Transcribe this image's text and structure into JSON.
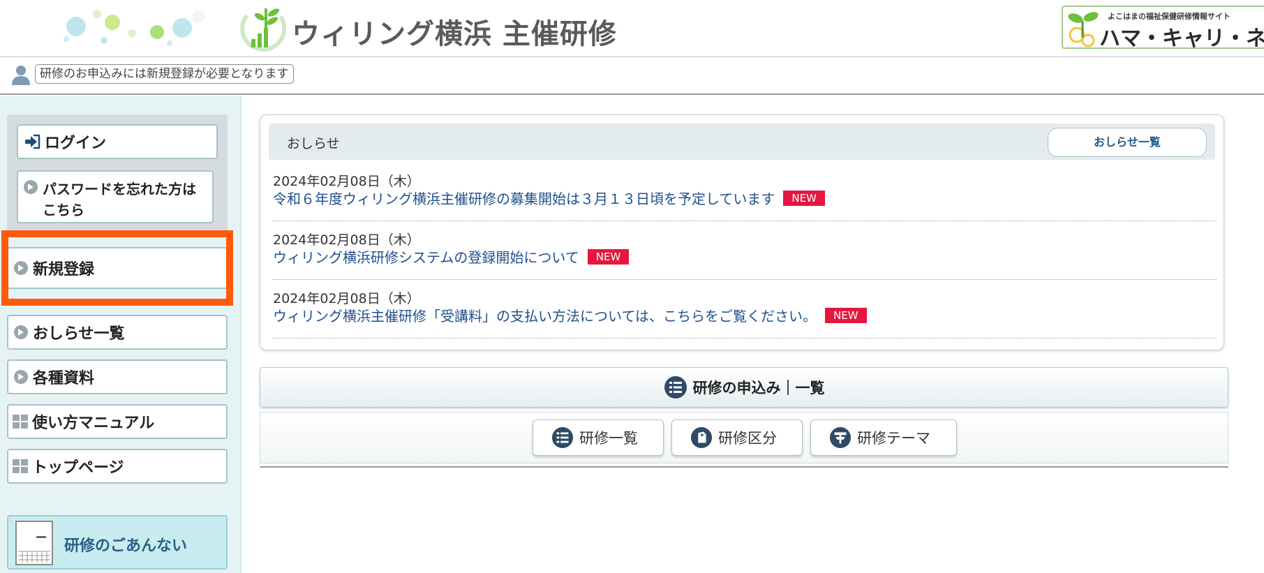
{
  "header": {
    "site_title": "ウィリング横浜 主催研修",
    "partner": {
      "tagline": "よこはまの福祉保健研修情報サイト",
      "name": "ハマ・キャリ・ネット"
    }
  },
  "notice_bar": {
    "text": "研修のお申込みには新規登録が必要となります"
  },
  "sidebar": {
    "login": "ログイン",
    "forgot_password": [
      "パスワードを忘れた方は",
      "こちら"
    ],
    "items": [
      {
        "label": "新規登録",
        "icon": "arrow-circle-icon"
      },
      {
        "label": "おしらせ一覧",
        "icon": "arrow-circle-icon"
      },
      {
        "label": "各種資料",
        "icon": "arrow-circle-icon"
      },
      {
        "label": "使い方マニュアル",
        "icon": "grid-icon"
      },
      {
        "label": "トップページ",
        "icon": "grid-icon"
      }
    ],
    "guide": "研修のごあんない"
  },
  "news": {
    "title": "おしらせ",
    "list_button": "おしらせ一覧",
    "items": [
      {
        "date": "2024年02月08日（木）",
        "title": "令和６年度ウィリング横浜主催研修の募集開始は３月１３日頃を予定しています",
        "badge": "NEW"
      },
      {
        "date": "2024年02月08日（木）",
        "title": "ウィリング横浜研修システムの登録開始について",
        "badge": "NEW"
      },
      {
        "date": "2024年02月08日（木）",
        "title": "ウィリング横浜主催研修「受講料」の支払い方法については、こちらをご覧ください。",
        "badge": "NEW"
      }
    ]
  },
  "apply": {
    "heading": "研修の申込み｜一覧",
    "buttons": [
      "研修一覧",
      "研修区分",
      "研修テーマ"
    ]
  },
  "colors": {
    "accent_orange": "#ff5a0a",
    "badge_red": "#e5173f",
    "link_blue": "#1f4f8f",
    "sidebar_bg": "#e6f3f5"
  }
}
